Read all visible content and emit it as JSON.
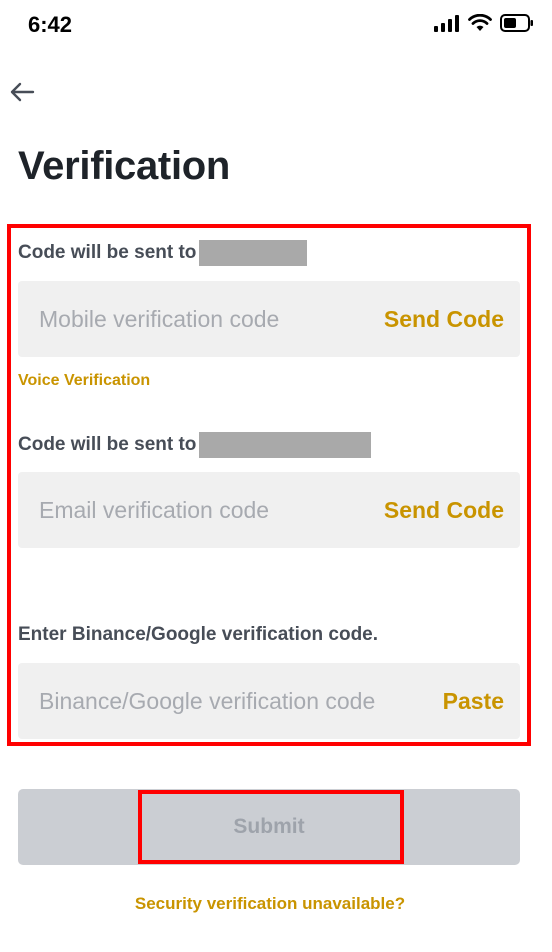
{
  "status_bar": {
    "time": "6:42",
    "icons": [
      "signal-icon",
      "wifi-icon",
      "battery-icon"
    ]
  },
  "header": {
    "back_icon": "arrow-left-icon",
    "title": "Verification"
  },
  "mobile": {
    "label": "Code will be sent to",
    "placeholder": "Mobile verification code",
    "value": "",
    "action": "Send Code",
    "voice_link": "Voice Verification"
  },
  "email": {
    "label": "Code will be sent to",
    "placeholder": "Email verification code",
    "value": "",
    "action": "Send Code"
  },
  "authenticator": {
    "label": "Enter Binance/Google verification code.",
    "placeholder": "Binance/Google verification code",
    "value": "",
    "action": "Paste"
  },
  "footer": {
    "submit_label": "Submit",
    "help_link": "Security verification unavailable?"
  },
  "colors": {
    "accent": "#c99400",
    "highlight": "#ff0000",
    "input_bg": "#f0f0f0",
    "button_disabled_bg": "#cbced3"
  }
}
